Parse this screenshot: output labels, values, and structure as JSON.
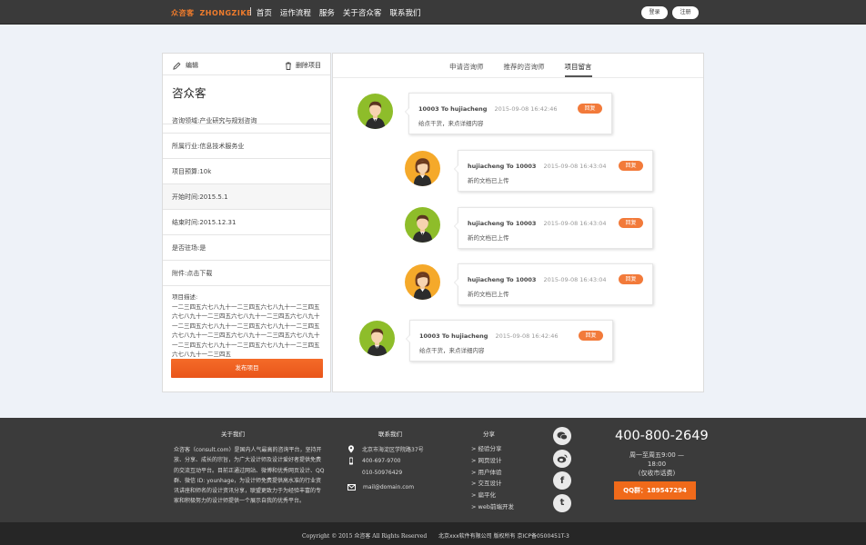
{
  "header": {
    "logo_cn": "众咨客",
    "logo_en": "ZHONGZIKE",
    "nav": [
      "首页",
      "运作流程",
      "服务",
      "关于咨众客",
      "联系我们"
    ],
    "login": "登录",
    "register": "注册"
  },
  "project": {
    "edit": "编辑",
    "delete": "删除项目",
    "title": "咨众客",
    "fields": [
      "咨询领域:产业研究与规划咨询",
      "所属行业:信息技术服务业",
      "项目预算:10k",
      "开始时间:2015.5.1",
      "结束时间:2015.12.31",
      "是否驻场:是",
      "附件:点击下载"
    ],
    "desc_label": "项目描述:",
    "desc_text": "一二三四五六七八九十一二三四五六七八九十一二三四五六七八九十一二三四五六七八九十一二三四五六七八九十一二三四五六七八九十一二三四五六七八九十一二三四五六七八九十一二三四五六七八九十一二三四五六七八九十一二三四五六七八九十一二三四五六七八九十一二三四五六七八九十一二三四五",
    "publish": "发布项目"
  },
  "tabs": [
    "申请咨询师",
    "推荐的咨询师",
    "项目留言"
  ],
  "messages": [
    {
      "who": "10003 To hujiacheng",
      "time": "2015-09-08 16:42:46",
      "text": "给点干货，来点详细内容",
      "reply": "回复"
    },
    {
      "who": "hujiacheng To 10003",
      "time": "2015-09-08 16:43:04",
      "text": "新的文档已上传",
      "reply": "回复"
    },
    {
      "who": "hujiacheng To 10003",
      "time": "2015-09-08 16:43:04",
      "text": "新的文档已上传",
      "reply": "回复"
    },
    {
      "who": "hujiacheng To 10003",
      "time": "2015-09-08 16:43:04",
      "text": "新的文档已上传",
      "reply": "回复"
    },
    {
      "who": "10003 To hujiacheng",
      "time": "2015-09-08 16:42:46",
      "text": "给点干货，来点详细内容",
      "reply": "回复"
    }
  ],
  "footer": {
    "about_title": "关于我们",
    "about_text": "众咨客（consult.com）是国内人气最高的咨询平台，坚持开放、分享、成长的宗旨，为广大设计师及设计爱好者提供免费的交流互动平台。目前正通过网站、微博和优秀网页设计、QQ群、微信 ID: younhage，为设计师免费提供高水准的行业资讯讲座和师名的设计资讯分享，联盟更致力于为经验丰富的专家和积极努力的设计师提供一个展示自我的优秀平台。",
    "contact_title": "联系我们",
    "address": "北京市海淀区学院路37号",
    "phone1": "400-697-9700",
    "phone2": "010-50976429",
    "email": "mail@domain.com",
    "share_title": "分享",
    "share_items": [
      "> 经验分享",
      "> 网页设计",
      "> 用户体验",
      "> 交互设计",
      "> 扁平化",
      "> web前端开发"
    ],
    "hotline": "400-800-2649",
    "hours": "周一至周五9:00 — 18:00",
    "hours_note": "(仅收市话费)",
    "qq": "QQ群：189547294",
    "copyright": "Copyright © 2015 众咨客  All Rights Reserved",
    "icp": "北京xxx软件有限公司 版权所有 京ICP备0500451T-3"
  },
  "colors": {
    "accent": "#f07c2c",
    "dark": "#3a3a3a"
  }
}
